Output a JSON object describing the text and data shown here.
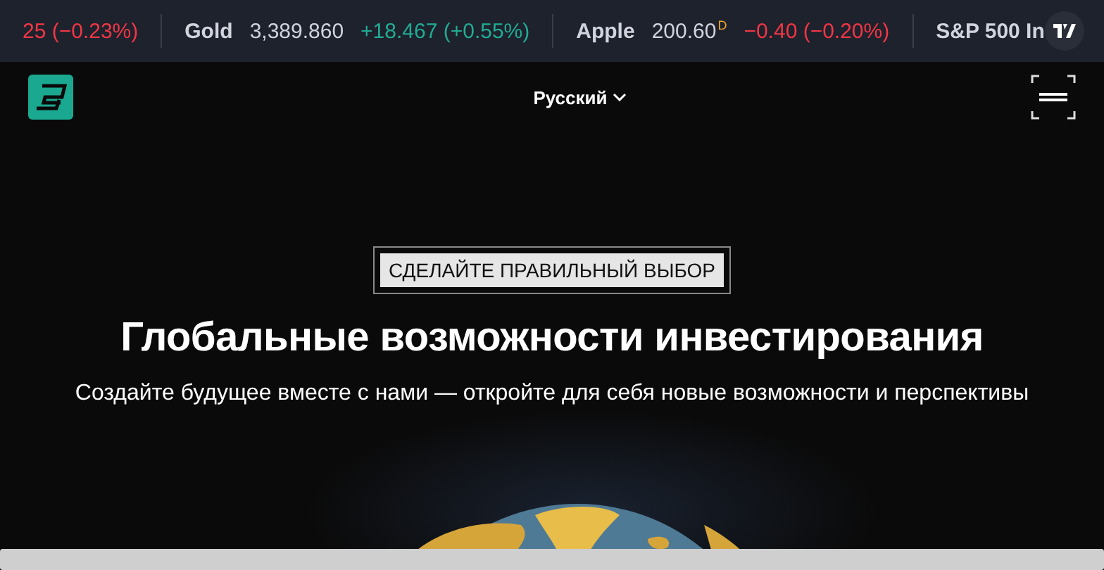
{
  "ticker": [
    {
      "change": "25 (−0.23%)",
      "color": "#f23645"
    },
    {
      "name": "Gold",
      "price": "3,389.860",
      "change": "+18.467 (+0.55%)",
      "color": "#22ab94"
    },
    {
      "name": "Apple",
      "price": "200.60",
      "flag": "D",
      "change": "−0.40 (−0.20%)",
      "color": "#f23645"
    },
    {
      "name": "S&P 500 In"
    }
  ],
  "header": {
    "language": "Русский"
  },
  "hero": {
    "badge": "СДЕЛАЙТЕ ПРАВИЛЬНЫЙ ВЫБОР",
    "title": "Глобальные возможности инвестирования",
    "subtitle": "Создайте будущее вместе с нами — откройте для себя новые возможности и перспективы"
  }
}
